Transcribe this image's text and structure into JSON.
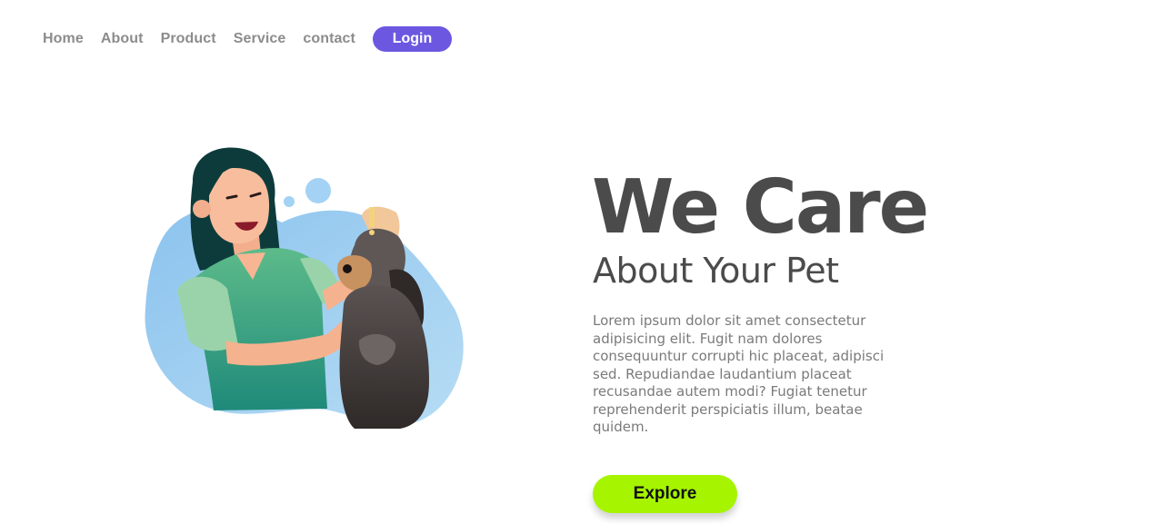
{
  "nav": {
    "items": [
      {
        "label": "Home"
      },
      {
        "label": "About"
      },
      {
        "label": "Product"
      },
      {
        "label": "Service"
      },
      {
        "label": "contact"
      }
    ],
    "login_label": "Login"
  },
  "hero": {
    "headline": "We Care",
    "subheadline": "About Your Pet",
    "description": "Lorem ipsum dolor sit amet consectetur adipisicing elit. Fugit nam dolores consequuntur corrupti hic placeat, adipisci sed. Repudiandae laudantium placeat recusandae autem modi? Fugiat tenetur reprehenderit perspiciatis illum, beatae quidem.",
    "cta_label": "Explore"
  },
  "colors": {
    "nav_text": "#8c8c8c",
    "login_bg": "#6b57e0",
    "heading": "#4b4b4b",
    "body_text": "#7a7a7a",
    "cta_bg": "#a6f400",
    "blob_blue": "#8fc4ea",
    "scrubs_green": "#3aa57e"
  },
  "illustration": {
    "icon": "woman-with-dog-illustration"
  }
}
